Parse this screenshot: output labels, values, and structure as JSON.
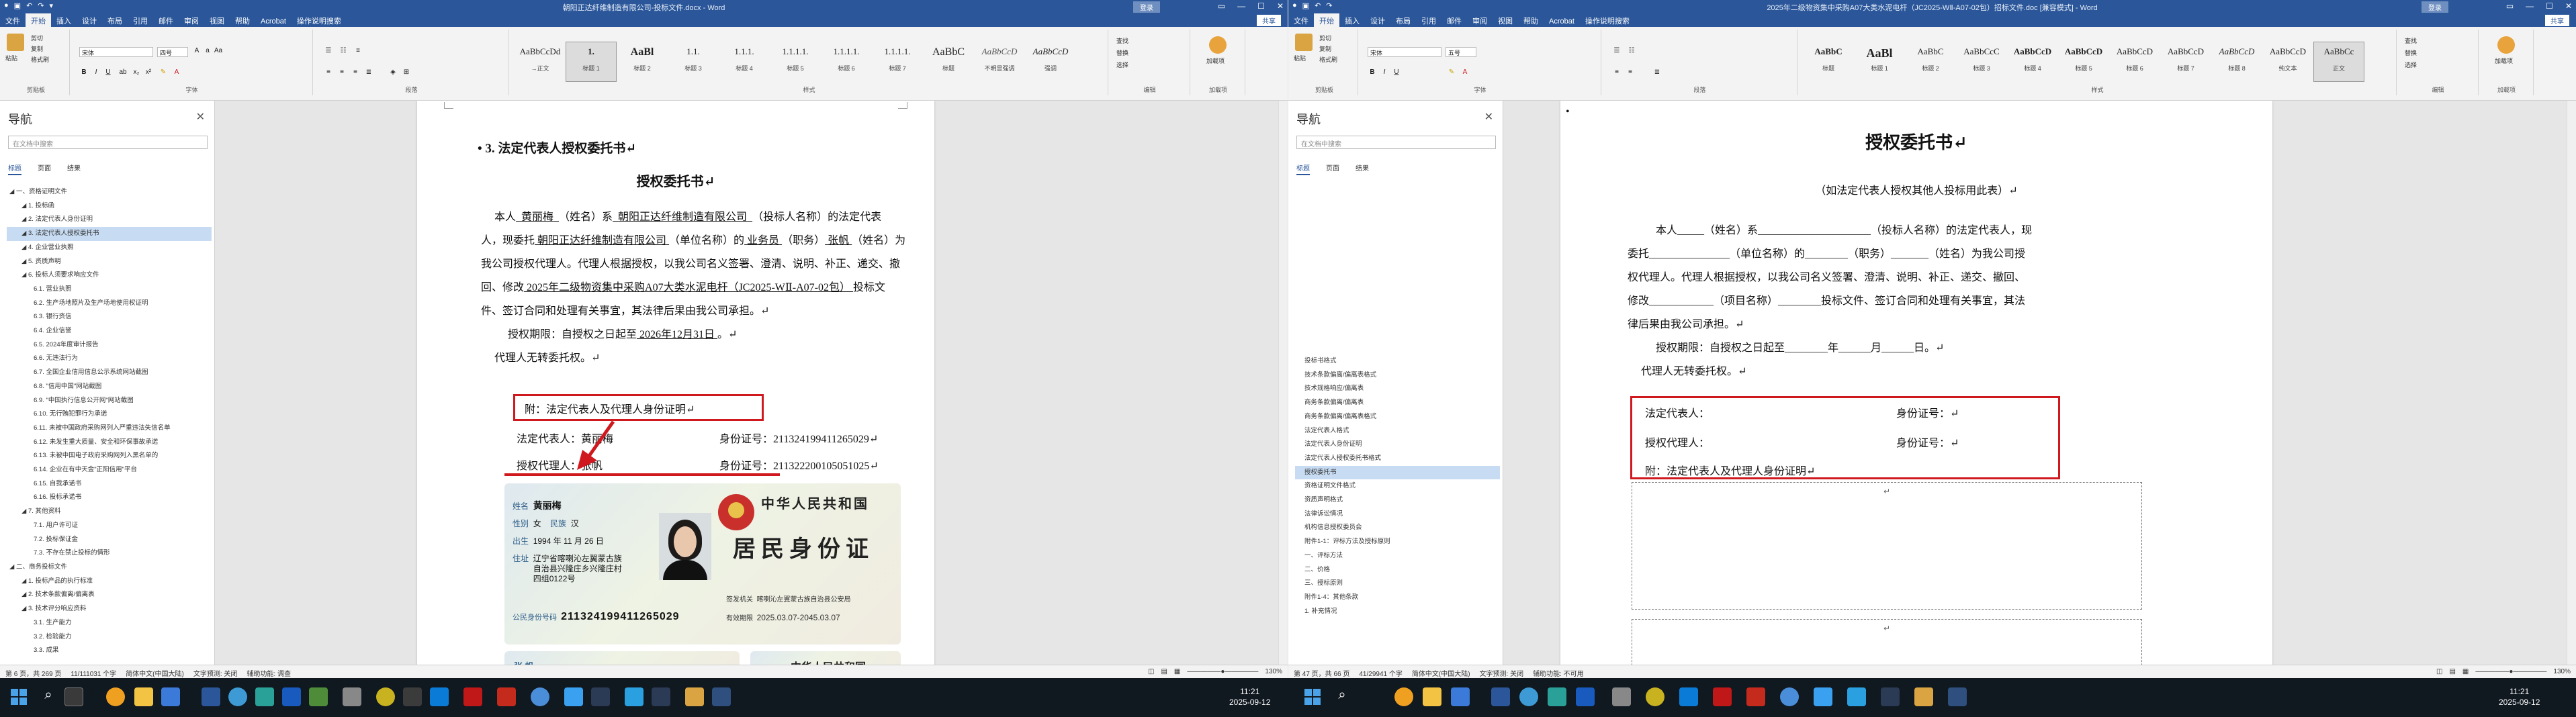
{
  "left": {
    "window_title": "朝阳正达纤维制造有限公司-投标文件.docx - Word",
    "ribbon_tabs": [
      "文件",
      "开始",
      "插入",
      "设计",
      "布局",
      "引用",
      "邮件",
      "审阅",
      "视图",
      "帮助",
      "Acrobat",
      "操作说明搜索"
    ],
    "share": "共享",
    "signin": "登录",
    "clipboard": {
      "paste": "粘贴",
      "cut": "剪切",
      "copy": "复制",
      "painter": "格式刷",
      "label": "剪贴板"
    },
    "font": {
      "name": "宋体",
      "size": "四号",
      "label": "字体"
    },
    "paragraph_label": "段落",
    "styles": [
      {
        "preview": "AaBbCcDd",
        "name": "→正文"
      },
      {
        "preview": "1.",
        "name": "标题 1"
      },
      {
        "preview": "AaBl",
        "name": "标题 2"
      },
      {
        "preview": "1.1.",
        "name": "标题 3"
      },
      {
        "preview": "1.1.1.",
        "name": "标题 4"
      },
      {
        "preview": "1.1.1.1.",
        "name": "标题 5"
      },
      {
        "preview": "1.1.1.1.",
        "name": "标题 6"
      },
      {
        "preview": "1.1.1.1.",
        "name": "标题 7"
      },
      {
        "preview": "AaBbC",
        "name": "标题"
      },
      {
        "preview": "AaBbCcD",
        "name": "不明显强调"
      },
      {
        "preview": "AaBbCcD",
        "name": "强调"
      }
    ],
    "styles_label": "样式",
    "editing": {
      "find": "查找",
      "replace": "替换",
      "select": "选择",
      "label": "编辑"
    },
    "addin": {
      "name": "加载项",
      "label": "加载项"
    },
    "nav": {
      "title": "导航",
      "search_placeholder": "在文档中搜索",
      "tabs": [
        "标题",
        "页面",
        "结果"
      ],
      "items": [
        "一、资格证明文件",
        "1. 投标函",
        "2. 法定代表人身份证明",
        "3. 法定代表人授权委托书",
        "4. 企业营业执照",
        "5. 资质声明",
        "6. 投标人须要求响应文件",
        "6.1. 营业执照",
        "6.2. 生产场地照片及生产场地使用权证明",
        "6.3. 银行资信",
        "6.4. 企业信誉",
        "6.5. 2024年度审计报告",
        "6.6. 无违法行为",
        "6.7. 全国企业信用信息公示系统网站截图",
        "6.8. \"信用中国\"网站截图",
        "6.9. \"中国执行信息公开网\"网站截图",
        "6.10. 无行贿犯罪行为承诺",
        "6.11. 未被中国政府采购网列入严重违法失信名单",
        "6.12. 未发生重大质量、安全和环保事故承诺",
        "6.13. 未被中国电子政府采购网列入黑名单的",
        "6.14. 企业在有中天金\"正阳信用\"平台",
        "6.15. 自我承诺书",
        "6.16. 投标承诺书",
        "7. 其他资料",
        "7.1. 用户许可证",
        "7.2. 投标保证金",
        "7.3. 不存在禁止投标的情形",
        "二、商务投标文件",
        "1. 投标产品的执行标准",
        "2. 技术条款偏离/偏离表",
        "3. 技术评分响应资料",
        "3.1. 生产能力",
        "3.2. 检验能力",
        "3.3. 成果"
      ]
    },
    "doc": {
      "section_heading": "3. 法定代表人授权委托书",
      "title": "授权委托书",
      "para1_a": "本人",
      "legal_rep": "黄丽梅",
      "para1_b": "（姓名）系",
      "company": "朝阳正达纤维制造有限公司",
      "para1_c": "（投标人名称）的法定代表",
      "para2_a": "人，现委托",
      "company2": "朝阳正达纤维制造有限公司",
      "para2_b": "（单位名称）的",
      "role": "业务员",
      "para2_c": "（职务）",
      "agent": "张帆",
      "para2_d": "（姓名）为",
      "para3": "我公司授权代理人。代理人根据授权，以我公司名义签署、澄清、说明、补正、递交、撤",
      "para4_a": "回、修改",
      "project": "2025年二级物资集中采购A07大类水泥电杆（JC2025-WⅡ-A07-02包）",
      "para4_b": "投标文",
      "para5": "件、签订合同和处理有关事宜，其法律后果由我公司承担。",
      "period_a": "授权期限：自授权之日起至",
      "period_date": "2026年12月31日",
      "period_b": "。",
      "no_sub": "代理人无转委托权。",
      "attach": "附：法定代表人及代理人身份证明",
      "rep_line": "法定代表人：黄丽梅",
      "rep_id": "身份证号：211324199411265029",
      "agent_line": "授权代理人：张帆",
      "agent_id": "身份证号：211322200105051025"
    },
    "idcard": {
      "name_label": "姓名",
      "name": "黄丽梅",
      "sex_label": "性别",
      "sex": "女",
      "nation_label": "民族",
      "nation": "汉",
      "birth_label": "出生",
      "birth": "1994 年 11 月 26 日",
      "addr_label": "住址",
      "addr": [
        "辽宁省喀喇沁左翼蒙古族",
        "自治县兴隆庄乡兴隆庄村",
        "四组0122号"
      ],
      "id_label": "公民身份号码",
      "id": "211324199411265029",
      "back_title1": "中华人民共和国",
      "back_title2": "居民身份证",
      "issuer_label": "签发机关",
      "issuer": "喀喇沁左翼蒙古族自治县公安局",
      "valid_label": "有效期限",
      "valid": "2025.03.07-2045.03.07",
      "card2_name": "张 帆",
      "card2_title": "中华人民共和国"
    },
    "status": {
      "page": "第 6 页，共 269 页",
      "words": "11/111031 个字",
      "lang": "简体中文(中国大陆)",
      "predict": "文字预测: 关闭",
      "access": "辅助功能: 调查",
      "zoom": "130%"
    }
  },
  "right": {
    "window_title": "2025年二级物资集中采购A07大类水泥电杆（JC2025-WⅡ-A07-02包）招标文件.doc [兼容模式] - Word",
    "ribbon_tabs": [
      "文件",
      "开始",
      "插入",
      "设计",
      "布局",
      "引用",
      "邮件",
      "审阅",
      "视图",
      "帮助",
      "Acrobat",
      "操作说明搜索"
    ],
    "share": "共享",
    "signin": "登录",
    "font": {
      "name": "宋体",
      "size": "五号"
    },
    "styles": [
      {
        "preview": "AaBbC",
        "name": "标题"
      },
      {
        "preview": "AaBl",
        "name": "标题 1"
      },
      {
        "preview": "AaBbC",
        "name": "标题 2"
      },
      {
        "preview": "AaBbCcC",
        "name": "标题 3"
      },
      {
        "preview": "AaBbCcD",
        "name": "标题 4"
      },
      {
        "preview": "AaBbCcD",
        "name": "标题 5"
      },
      {
        "preview": "AaBbCcD",
        "name": "标题 6"
      },
      {
        "preview": "AaBbCcD",
        "name": "标题 7"
      },
      {
        "preview": "AaBbCcD",
        "name": "标题 8"
      },
      {
        "preview": "AaBbCcD",
        "name": "纯文本"
      },
      {
        "preview": "AaBbCc",
        "name": "正文"
      }
    ],
    "nav": {
      "title": "导航",
      "search_placeholder": "在文档中搜索",
      "tabs": [
        "标题",
        "页面",
        "结果"
      ],
      "items": [
        "投标书格式",
        "技术条款偏离/偏离表格式",
        "技术规格响应/偏离表",
        "",
        "商务条款偏离/偏离表",
        "商务条款偏离/偏离表格式",
        "法定代表人格式",
        "法定代表人身份证明",
        "法定代表人授权委托书格式",
        "授权委托书",
        "资格证明文件格式",
        "资质声明格式",
        "法律诉讼情况",
        "",
        "机构信息授权委员会",
        "附件1-1：评标方法及授标原则",
        "一、评标方法",
        "二、价格",
        "三、授标原则",
        "附件1-4：其他条款",
        "1. 补充情况"
      ]
    },
    "doc": {
      "title": "授权委托书",
      "subtitle": "（如法定代表人授权其他人投标用此表）",
      "para1": "本人_____（姓名）系_____________________（投标人名称）的法定代表人，现",
      "para2": "委托_______________（单位名称）的________（职务）_______（姓名）为我公司授",
      "para3": "权代理人。代理人根据授权，以我公司名义签署、澄清、说明、补正、递交、撤回、",
      "para4": "修改____________（项目名称）________投标文件、签订合同和处理有关事宜，其法",
      "para5": "律后果由我公司承担。",
      "period": "授权期限：自授权之日起至________年______月______日。",
      "no_sub": "代理人无转委托权。",
      "rep": "法定代表人：",
      "rep_id": "身份证号：",
      "agent": "授权代理人：",
      "agent_id": "身份证号：",
      "attach": "附：法定代表人及代理人身份证明"
    },
    "status": {
      "page": "第 47 页，共 66 页",
      "words": "41/29941 个字",
      "lang": "简体中文(中国大陆)",
      "predict": "文字预测: 关闭",
      "access": "辅助功能: 不可用",
      "zoom": "130%"
    }
  },
  "taskbar": {
    "clock_left": {
      "time": "11:21",
      "date": "2025-09-12"
    },
    "clock_right": {
      "time": "11:21",
      "date": "2025-09-12"
    }
  },
  "colors": {
    "word_blue": "#2b579a",
    "highlight_red": "#d0191f",
    "nav_selected": "#c7dcf3"
  }
}
